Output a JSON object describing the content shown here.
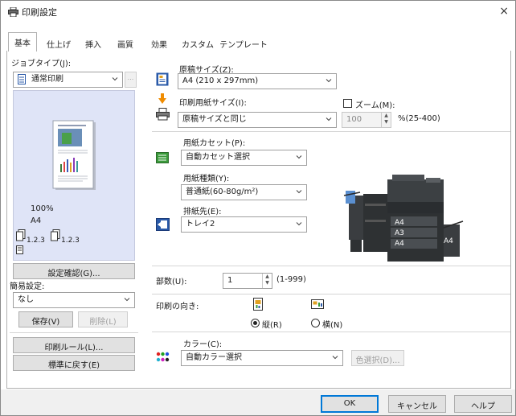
{
  "window": {
    "title": "印刷設定",
    "close": "×"
  },
  "tabs": [
    {
      "label": "基本",
      "active": true
    },
    {
      "label": "仕上げ"
    },
    {
      "label": "挿入"
    },
    {
      "label": "画質"
    },
    {
      "label": "効果"
    },
    {
      "label": "カスタム"
    },
    {
      "label": "テンプレート"
    }
  ],
  "left": {
    "job_type_label": "ジョブタイプ(J):",
    "job_type_value": "通常印刷",
    "job_type_more": "...",
    "preview": {
      "zoom_text": "100%",
      "paper_text": "A4",
      "tray_numbers_1": "1.2.3",
      "tray_numbers_2": "1.2.3"
    },
    "confirm_button": "設定確認(G)...",
    "easy_setting_label": "簡易設定:",
    "easy_setting_value": "なし",
    "save_button": "保存(V)",
    "delete_button": "削除(L)",
    "print_rule_button": "印刷ルール(L)...",
    "restore_default_button": "標準に戻す(E)"
  },
  "main": {
    "original_size_label": "原稿サイズ(Z):",
    "original_size_value": "A4 (210 x 297mm)",
    "print_paper_label": "印刷用紙サイズ(I):",
    "print_paper_value": "原稿サイズと同じ",
    "zoom_label": "ズーム(M):",
    "zoom_value": "100",
    "zoom_range": "%(25-400)",
    "cassette_label": "用紙カセット(P):",
    "cassette_value": "自動カセット選択",
    "paper_type_label": "用紙種類(Y):",
    "paper_type_value": "普通紙(60-80g/m²)",
    "output_label": "排紙先(E):",
    "output_value": "トレイ2",
    "printer_trays": [
      "A4",
      "A3",
      "A4"
    ],
    "printer_side_tray": "A4",
    "copies_label": "部数(U):",
    "copies_value": "1",
    "copies_range": "(1-999)",
    "orientation_label": "印刷の向き:",
    "portrait_label": "縦(R)",
    "landscape_label": "横(N)",
    "color_label": "カラー(C):",
    "color_value": "自動カラー選択",
    "color_select_button": "色選択(D)..."
  },
  "footer": {
    "ok": "OK",
    "cancel": "キャンセル",
    "help": "ヘルプ"
  },
  "colors": {
    "accent": "#0078d7",
    "preview_bg": "#dfe4f7",
    "printer_dark": "#2e3133",
    "icon_blue": "#2a5aa8",
    "icon_orange": "#f08c00",
    "icon_green": "#3a9a3a"
  }
}
